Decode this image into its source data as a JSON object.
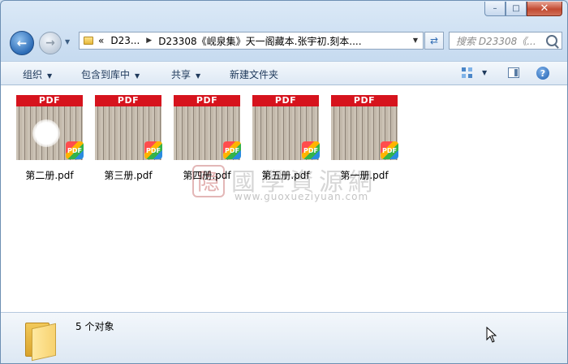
{
  "window": {
    "caption_buttons": {
      "minimize": "–",
      "maximize": "□",
      "close": "✕"
    }
  },
  "nav": {
    "back_icon": "arrow-left-icon",
    "forward_icon": "arrow-right-icon",
    "address_segments": [
      "D23...",
      "D23308《岘泉集》天一阁藏本.张宇初.刻本...."
    ],
    "address_prefix": "«",
    "search_placeholder": "搜索 D23308《..."
  },
  "toolbar": {
    "organize": "组织",
    "include_in_library": "包含到库中",
    "share": "共享",
    "new_folder": "新建文件夹"
  },
  "files": [
    {
      "name": "第二册.pdf",
      "banner": "PDF",
      "badge": "PDF",
      "blot": true
    },
    {
      "name": "第三册.pdf",
      "banner": "PDF",
      "badge": "PDF",
      "blot": false
    },
    {
      "name": "第四册.pdf",
      "banner": "PDF",
      "badge": "PDF",
      "blot": false
    },
    {
      "name": "第五册.pdf",
      "banner": "PDF",
      "badge": "PDF",
      "blot": false
    },
    {
      "name": "第一册.pdf",
      "banner": "PDF",
      "badge": "PDF",
      "blot": false
    }
  ],
  "watermark": {
    "seal": "隐",
    "text": "國學資源網",
    "url": "www.guoxueziyuan.com"
  },
  "status": {
    "count": "5 个对象"
  },
  "colors": {
    "pdf_red": "#d6131d",
    "accent": "#1e395b"
  }
}
